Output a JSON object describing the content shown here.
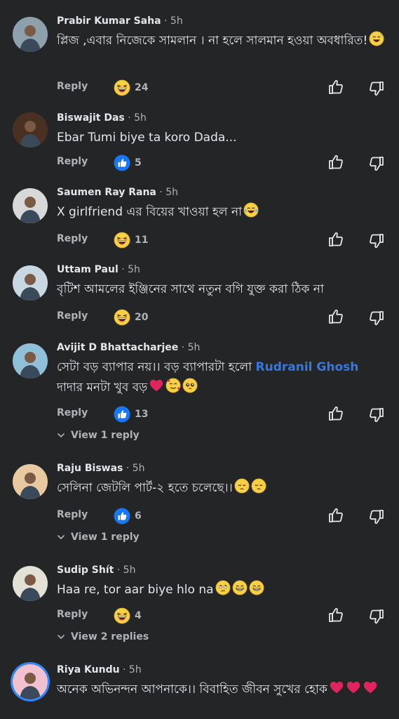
{
  "comments": [
    {
      "author": "Prabir Kumar Saha",
      "time": "5h",
      "text": "প্লিজ ,এবার নিজেকে সামলান । না হলে সালমান হওয়া অবধারিত!",
      "emoji": [
        "sweat-smile"
      ],
      "reply_label": "Reply",
      "reaction_icon": "laugh-emoji",
      "reaction_count": "24"
    },
    {
      "author": "Biswajit Das",
      "time": "5h",
      "text": "Ebar Tumi biye ta koro Dada...",
      "emoji": [],
      "reply_label": "Reply",
      "reaction_icon": "like-reaction",
      "reaction_count": "5"
    },
    {
      "author": "Saumen Ray Rana",
      "time": "5h",
      "text": "X girlfriend এর বিয়ের খাওয়া হল না",
      "emoji": [
        "tears-of-joy"
      ],
      "reply_label": "Reply",
      "reaction_icon": "laugh-emoji",
      "reaction_count": "11"
    },
    {
      "author": "Uttam Paul",
      "time": "5h",
      "text": "বৃটিশ আমলের ইঞ্জিনের সাথে নতুন বগি যুক্ত করা ঠিক না",
      "emoji": [],
      "reply_label": "Reply",
      "reaction_icon": "laugh-emoji",
      "reaction_count": "20"
    },
    {
      "author": "Avijit D Bhattacharjee",
      "time": "5h",
      "text_before": "সেটা বড় ব্যাপার নয়।। বড় ব্যাপারটা হলো ",
      "mention": "Rudranil Ghosh",
      "text_after": " দাদার মনটা খুব বড়",
      "emoji": [
        "red-heart",
        "smiling-with-hearts",
        "pleading"
      ],
      "reply_label": "Reply",
      "reaction_icon": "like-reaction",
      "reaction_count": "13",
      "view_replies": "View 1 reply"
    },
    {
      "author": "Raju Biswas",
      "time": "5h",
      "text": "সেলিনা জেটলি পার্ট-২ হতে চলেছে।।",
      "emoji": [
        "pensive",
        "pensive"
      ],
      "reply_label": "Reply",
      "reaction_icon": "like-reaction",
      "reaction_count": "6",
      "view_replies": "View 1 reply"
    },
    {
      "author": "Sudip Shít",
      "time": "5h",
      "text": "Haa re, tor aar biye hlo na",
      "emoji": [
        "eye-roll",
        "grin",
        "grin"
      ],
      "reply_label": "Reply",
      "reaction_icon": "laugh-emoji",
      "reaction_count": "4",
      "view_replies": "View 2 replies"
    },
    {
      "author": "Riya Kundu",
      "time": "5h",
      "text": "অনেক অভিনন্দন আপনাকে।। বিবাহিত জীবন সুখের হোক",
      "emoji": [
        "red-heart",
        "red-heart",
        "red-heart"
      ]
    }
  ],
  "colors": {
    "background": "#242526",
    "text": "#e4e6eb",
    "muted": "#b0b3b8",
    "mention": "#3578e5",
    "like_blue": "#1877f2",
    "laugh_yellow": "#f7d046"
  }
}
